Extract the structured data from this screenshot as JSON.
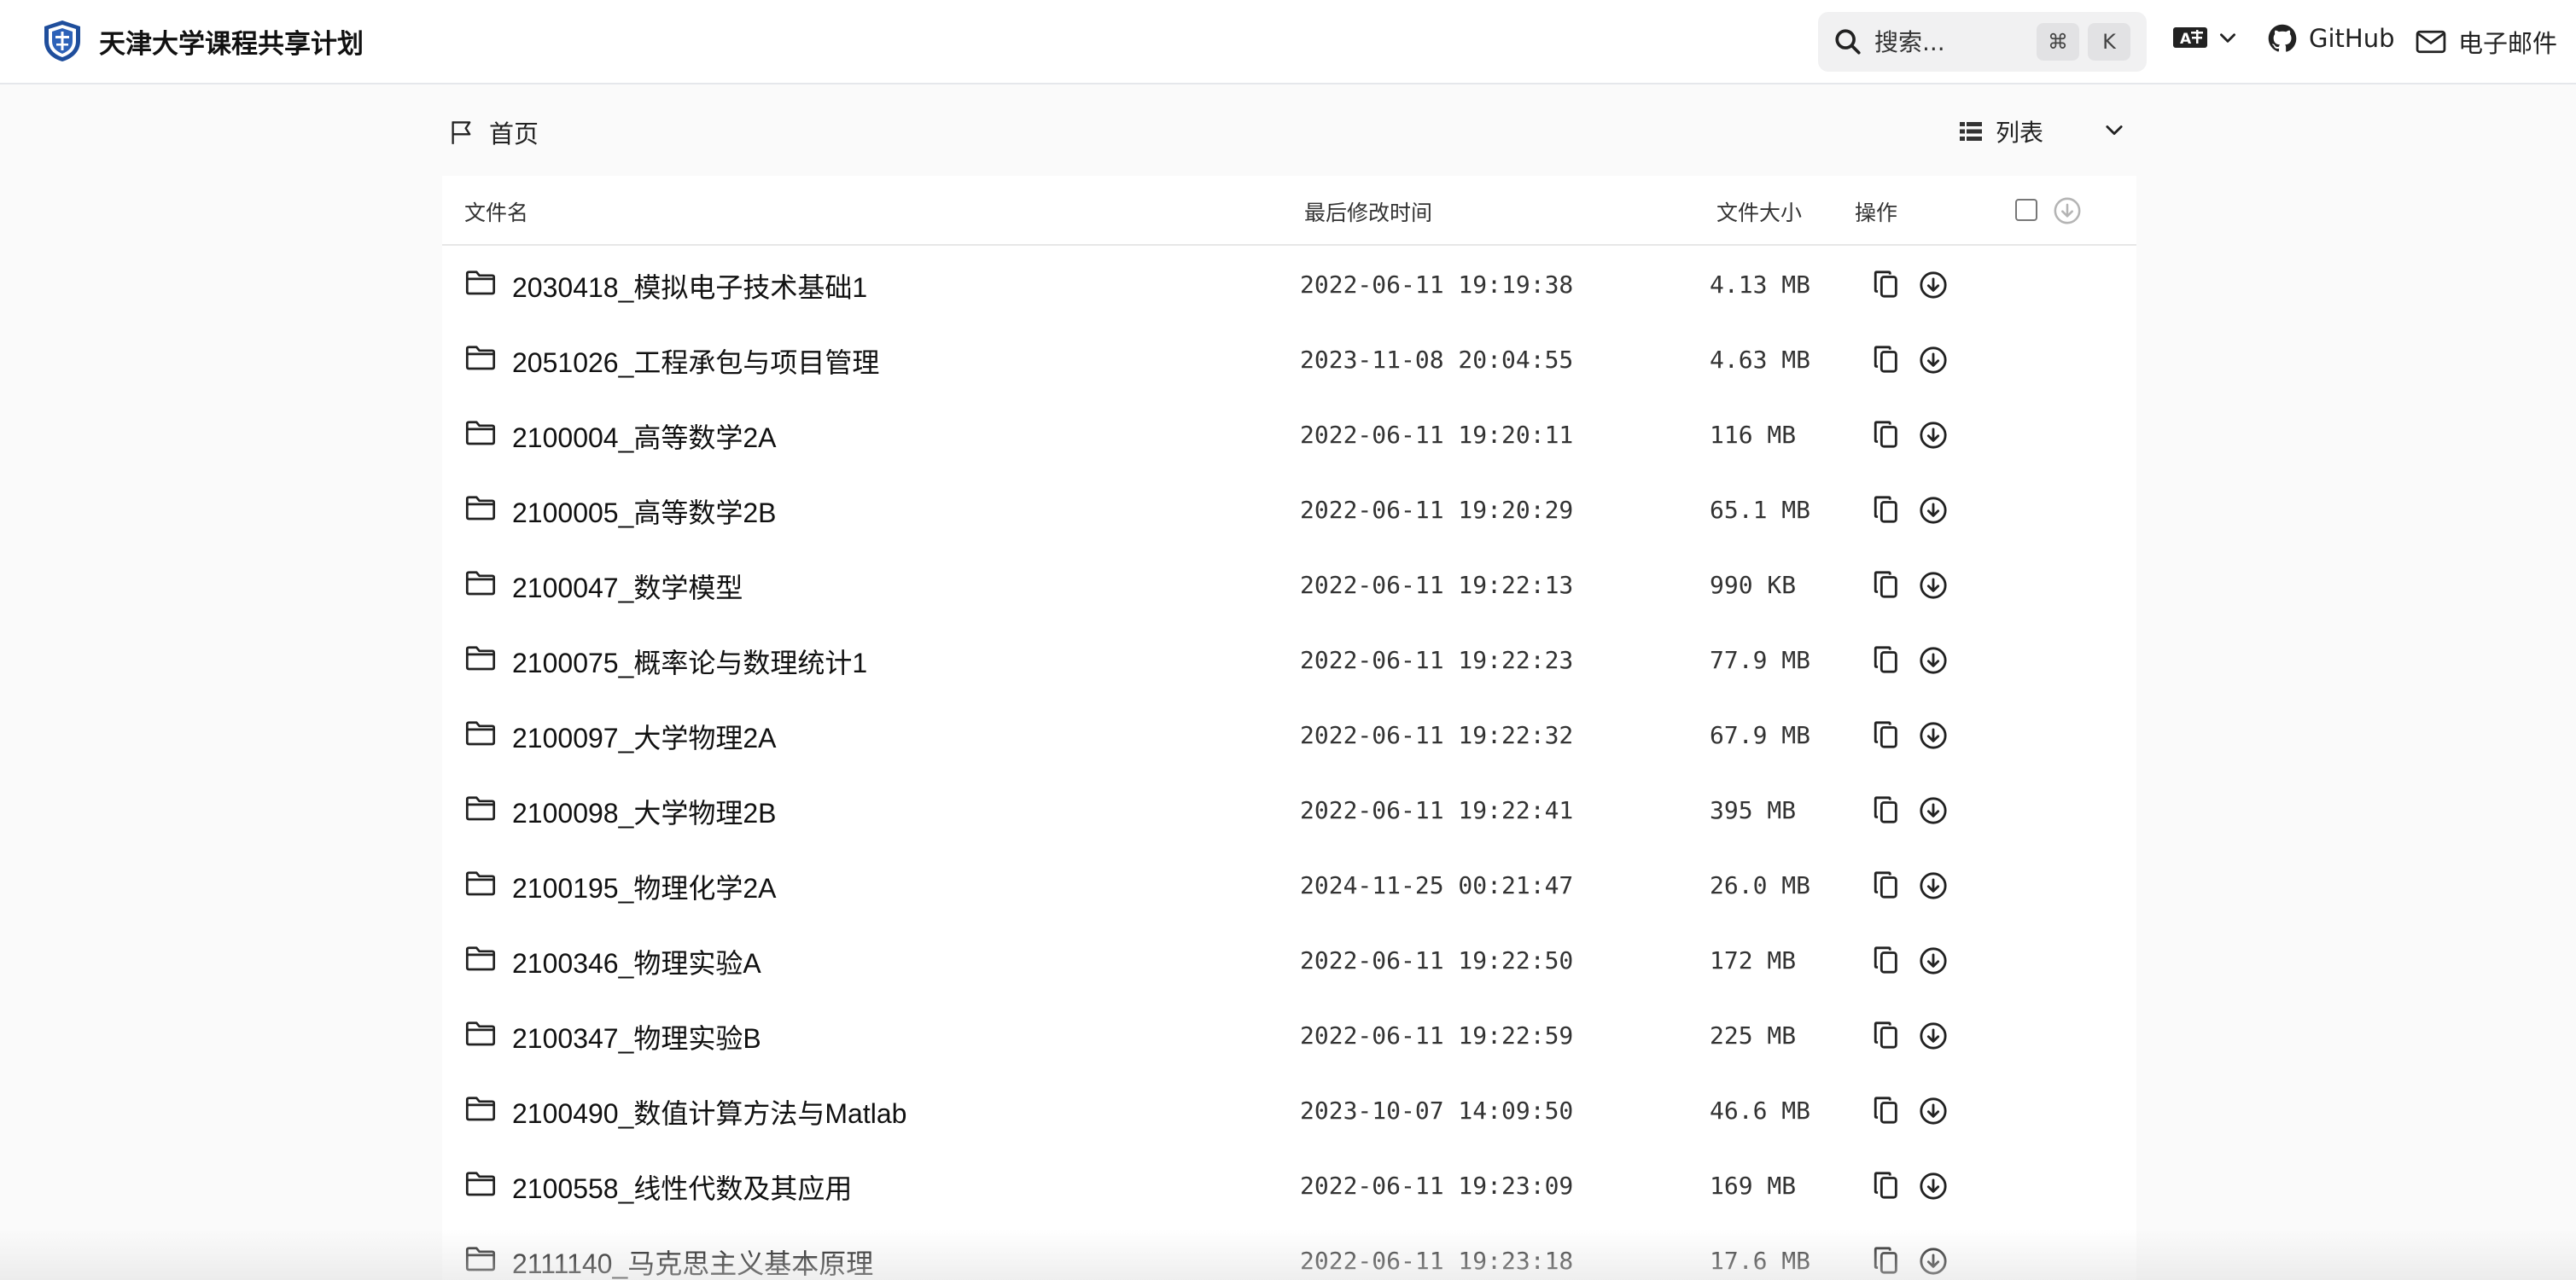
{
  "app": {
    "title": "天津大学课程共享计划"
  },
  "header": {
    "search": {
      "placeholder": "搜索...",
      "shortcut_modifier": "⌘",
      "shortcut_key": "K"
    },
    "links": [
      {
        "label": "GitHub",
        "icon": "github-icon"
      },
      {
        "label": "电子邮件",
        "icon": "mail-icon"
      }
    ],
    "language_icon": "translate-icon"
  },
  "toolbar": {
    "breadcrumb_home": "首页",
    "view_mode": "列表"
  },
  "table": {
    "columns": [
      "文件名",
      "最后修改时间",
      "文件大小",
      "操作"
    ],
    "rows": [
      {
        "name": "2030418_模拟电子技术基础1",
        "modified": "2022-06-11 19:19:38",
        "size": "4.13 MB"
      },
      {
        "name": "2051026_工程承包与项目管理",
        "modified": "2023-11-08 20:04:55",
        "size": "4.63 MB"
      },
      {
        "name": "2100004_高等数学2A",
        "modified": "2022-06-11 19:20:11",
        "size": "116 MB"
      },
      {
        "name": "2100005_高等数学2B",
        "modified": "2022-06-11 19:20:29",
        "size": "65.1 MB"
      },
      {
        "name": "2100047_数学模型",
        "modified": "2022-06-11 19:22:13",
        "size": "990 KB"
      },
      {
        "name": "2100075_概率论与数理统计1",
        "modified": "2022-06-11 19:22:23",
        "size": "77.9 MB"
      },
      {
        "name": "2100097_大学物理2A",
        "modified": "2022-06-11 19:22:32",
        "size": "67.9 MB"
      },
      {
        "name": "2100098_大学物理2B",
        "modified": "2022-06-11 19:22:41",
        "size": "395 MB"
      },
      {
        "name": "2100195_物理化学2A",
        "modified": "2024-11-25 00:21:47",
        "size": "26.0 MB"
      },
      {
        "name": "2100346_物理实验A",
        "modified": "2022-06-11 19:22:50",
        "size": "172 MB"
      },
      {
        "name": "2100347_物理实验B",
        "modified": "2022-06-11 19:22:59",
        "size": "225 MB"
      },
      {
        "name": "2100490_数值计算方法与Matlab",
        "modified": "2023-10-07 14:09:50",
        "size": "46.6 MB"
      },
      {
        "name": "2100558_线性代数及其应用",
        "modified": "2022-06-11 19:23:09",
        "size": "169 MB"
      },
      {
        "name": "2111140_马克思主义基本原理",
        "modified": "2022-06-11 19:23:18",
        "size": "17.6 MB"
      }
    ]
  },
  "colors": {
    "background": "#fafafa",
    "surface": "#ffffff",
    "text": "#111111",
    "border": "#e7e7e7",
    "logo_blue": "#1f4e9c"
  }
}
